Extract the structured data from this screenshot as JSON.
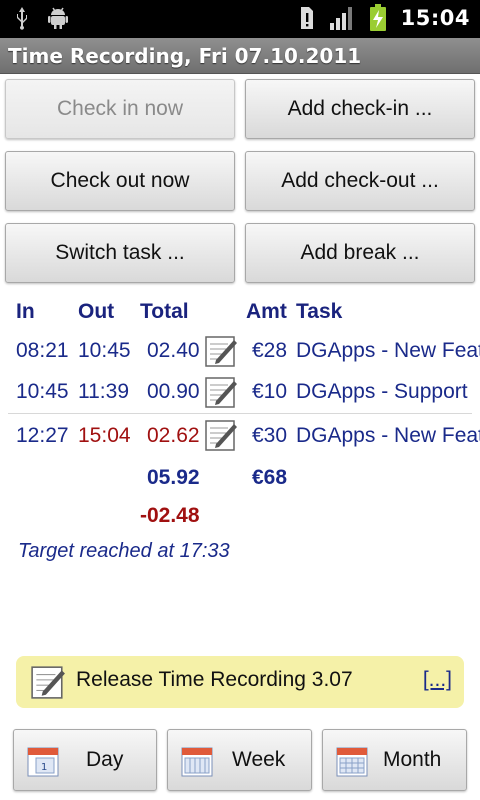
{
  "status_bar": {
    "time": "15:04",
    "icons": [
      "usb-icon",
      "android-debug-icon",
      "alert-icon",
      "signal-icon",
      "battery-charging-icon"
    ]
  },
  "title": "Time Recording, Fri 07.10.2011",
  "buttons": {
    "check_in": "Check in now",
    "add_check_in": "Add check-in ...",
    "check_out": "Check out now",
    "add_check_out": "Add check-out ...",
    "switch_task": "Switch task ...",
    "add_break": "Add break ..."
  },
  "table": {
    "headers": {
      "in": "In",
      "out": "Out",
      "total": "Total",
      "amt": "Amt",
      "task": "Task"
    },
    "rows": [
      {
        "in": "08:21",
        "out": "10:45",
        "total": "02.40",
        "amt": "€28",
        "task": "DGApps - New Feature"
      },
      {
        "in": "10:45",
        "out": "11:39",
        "total": "00.90",
        "amt": "€10",
        "task": "DGApps - Support"
      },
      {
        "in": "12:27",
        "out": "15:04",
        "total": "02.62",
        "amt": "€30",
        "task": "DGApps - New Feature"
      }
    ],
    "sum_total": "05.92",
    "sum_amt": "€68",
    "remaining": "-02.48"
  },
  "target_text": "Target reached at 17:33",
  "note": {
    "text": "Release Time Recording 3.07",
    "more": "[...]"
  },
  "nav": {
    "day": "Day",
    "week": "Week",
    "month": "Month"
  },
  "colors": {
    "header_blue": "#1a237e",
    "value_blue": "#1a2a8a",
    "value_red": "#a01010",
    "note_yellow": "#f5f1a8"
  }
}
